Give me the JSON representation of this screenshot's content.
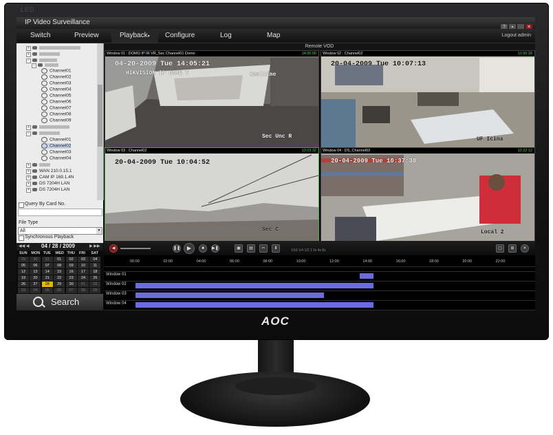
{
  "monitor": {
    "led": "LED",
    "brand": "AOC"
  },
  "app": {
    "title": "IP Video Surveillance"
  },
  "menu": {
    "switch": "Switch",
    "preview": "Preview",
    "playback": "Playback",
    "configure": "Configure",
    "log": "Log",
    "map": "Map",
    "logout": "Logout admin"
  },
  "tree": {
    "ch01": "Channel01",
    "ch02": "Channel02",
    "ch03": "Channel03",
    "ch04": "Channel04",
    "ch05": "Channel05",
    "ch06": "Channel06",
    "ch07": "Channel07",
    "ch08": "Channel08",
    "ch09": "Channel09",
    "g2ch01": "Channel01",
    "g2ch02": "Channel02",
    "g2ch03": "Channel03",
    "g2ch04": "Channel04",
    "wan": "WAN 210.0.15.1",
    "cam": "CAM IP 169.1.4N",
    "ds": "DS 7204H LAN",
    "ds2": "DS 7204H LAN"
  },
  "options": {
    "query_label": "Query By Card No.",
    "filetype_label": "File Type",
    "filetype_value": "All",
    "sync_label": "Synchronous Playback"
  },
  "calendar": {
    "date": "04 / 28 / 2009",
    "prev": "◀◀ ◀",
    "next": "▶ ▶▶",
    "days": [
      "SUN",
      "MON",
      "TUE",
      "WED",
      "THU",
      "FRI",
      "SAT"
    ],
    "rows": [
      [
        "29",
        "30",
        "31",
        "01",
        "02",
        "03",
        "04"
      ],
      [
        "05",
        "06",
        "07",
        "08",
        "09",
        "10",
        "11"
      ],
      [
        "12",
        "13",
        "14",
        "15",
        "16",
        "17",
        "18"
      ],
      [
        "19",
        "20",
        "21",
        "22",
        "23",
        "24",
        "25"
      ],
      [
        "26",
        "27",
        "28",
        "29",
        "30",
        "01",
        "02"
      ],
      [
        "03",
        "04",
        "05",
        "06",
        "07",
        "08",
        "09"
      ]
    ]
  },
  "search": {
    "label": "Search"
  },
  "remote": {
    "title": "Remote VOD"
  },
  "panes": {
    "p1": {
      "label": "Window 01 : DOMO IP IR VR_Sec Channel01 Domo",
      "time": "14:00:00",
      "osd": "04-20-2009 Tue 14:05:21",
      "osd2": "HIKVISION IP DOME T",
      "osd3": "Realtime",
      "osd4": "Sec Unc R"
    },
    "p2": {
      "label": "Window 02 : Channel02",
      "time": "11:00:18",
      "osd": "20-04-2009 Tue 10:07:13",
      "osd2": "UF Icina"
    },
    "p3": {
      "label": "Window 03 : Channel02",
      "time": "13:03:32",
      "osd": "20-04-2009 Tue 10:04:52",
      "osd2": "Sec C"
    },
    "p4": {
      "label": "Window 04 : DS_Channel03",
      "time": "12:22:12",
      "osd": "20-04-2009 Tue 10:37:38",
      "osd2": "Local 2"
    }
  },
  "controls": {
    "speeds": "1/16  1/4  1/2   1   2x   4x   8x"
  },
  "timeline": {
    "ticks": [
      "00:00",
      "02:00",
      "04:00",
      "06:00",
      "08:00",
      "10:00",
      "12:00",
      "14:00",
      "16:00",
      "18:00",
      "20:00",
      "22:00"
    ],
    "rows": [
      "Window 01",
      "Window 02",
      "Window 03",
      "Window 04"
    ],
    "recordings": [
      {
        "window": "Window 01",
        "start": "13:30",
        "end": "14:20"
      },
      {
        "window": "Window 02",
        "start": "00:00",
        "end": "14:20"
      },
      {
        "window": "Window 03",
        "start": "00:00",
        "end": "11:20"
      },
      {
        "window": "Window 04",
        "start": "00:00",
        "end": "14:20"
      }
    ]
  },
  "colors": {
    "recording": "#6b6be0",
    "active_border": "#4aa84a",
    "today": "#e8b800"
  }
}
